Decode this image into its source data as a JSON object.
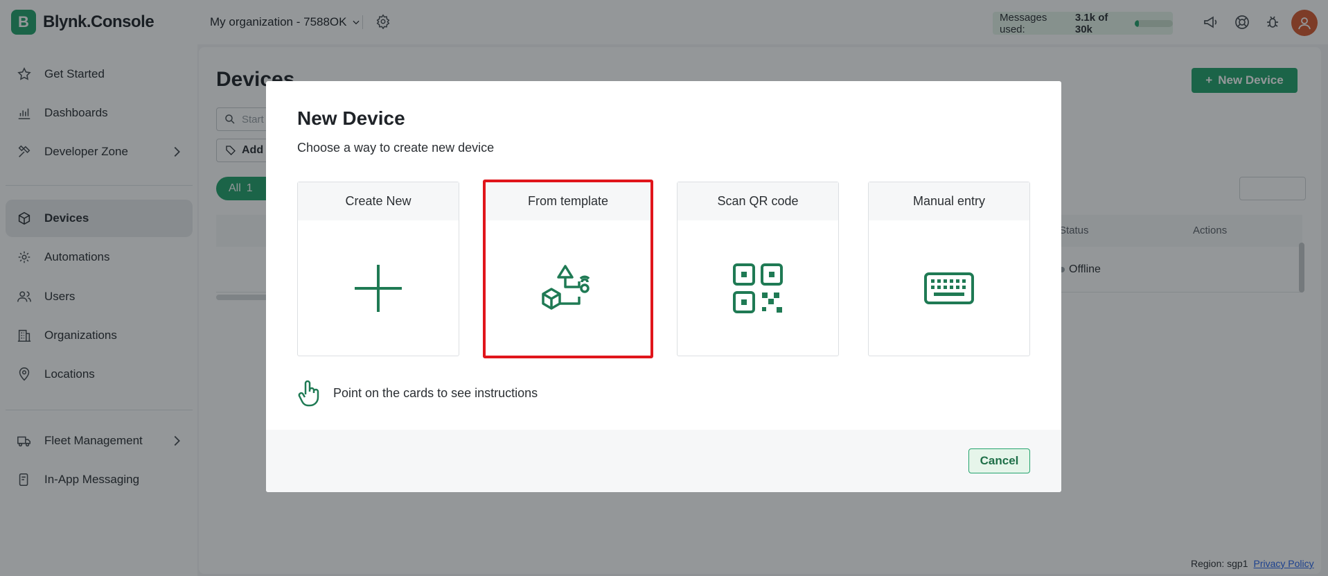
{
  "app": {
    "logo_letter": "B",
    "name": "Blynk.Console"
  },
  "sidebar": {
    "items": [
      {
        "label": "Get Started",
        "icon": "star-icon"
      },
      {
        "label": "Dashboards",
        "icon": "chart-icon"
      },
      {
        "label": "Developer Zone",
        "icon": "tools-icon",
        "has_submenu": true
      },
      {
        "label": "Devices",
        "icon": "cube-icon",
        "active": true
      },
      {
        "label": "Automations",
        "icon": "automation-icon"
      },
      {
        "label": "Users",
        "icon": "users-icon"
      },
      {
        "label": "Organizations",
        "icon": "building-icon"
      },
      {
        "label": "Locations",
        "icon": "pin-icon"
      },
      {
        "label": "Fleet Management",
        "icon": "truck-icon",
        "has_submenu": true
      },
      {
        "label": "In-App Messaging",
        "icon": "message-icon"
      }
    ]
  },
  "topbar": {
    "org_name": "My organization - 7588OK",
    "usage_label": "Messages used:",
    "usage_value": "3.1k of 30k",
    "usage_fraction": 0.103
  },
  "main": {
    "title": "Devices",
    "new_device_label": "New Device",
    "search_placeholder": "Start",
    "add_label": "Add",
    "all_filter": "All",
    "all_count": "1",
    "columns": {
      "status": "Status",
      "actions": "Actions"
    },
    "rows": [
      {
        "status": "Offline"
      }
    ]
  },
  "footer": {
    "region": "Region: sgp1",
    "privacy": "Privacy Policy"
  },
  "modal": {
    "title": "New Device",
    "subtitle": "Choose a way to create new device",
    "cards": [
      {
        "label": "Create New",
        "icon": "plus-icon"
      },
      {
        "label": "From template",
        "icon": "template-icon",
        "highlighted": true
      },
      {
        "label": "Scan QR code",
        "icon": "qr-code-icon"
      },
      {
        "label": "Manual entry",
        "icon": "keyboard-icon"
      }
    ],
    "hint": "Point on the cards to see instructions",
    "cancel_label": "Cancel"
  },
  "colors": {
    "brand": "#23a36c",
    "highlight": "#e0151b",
    "icon": "#1f7a54"
  }
}
